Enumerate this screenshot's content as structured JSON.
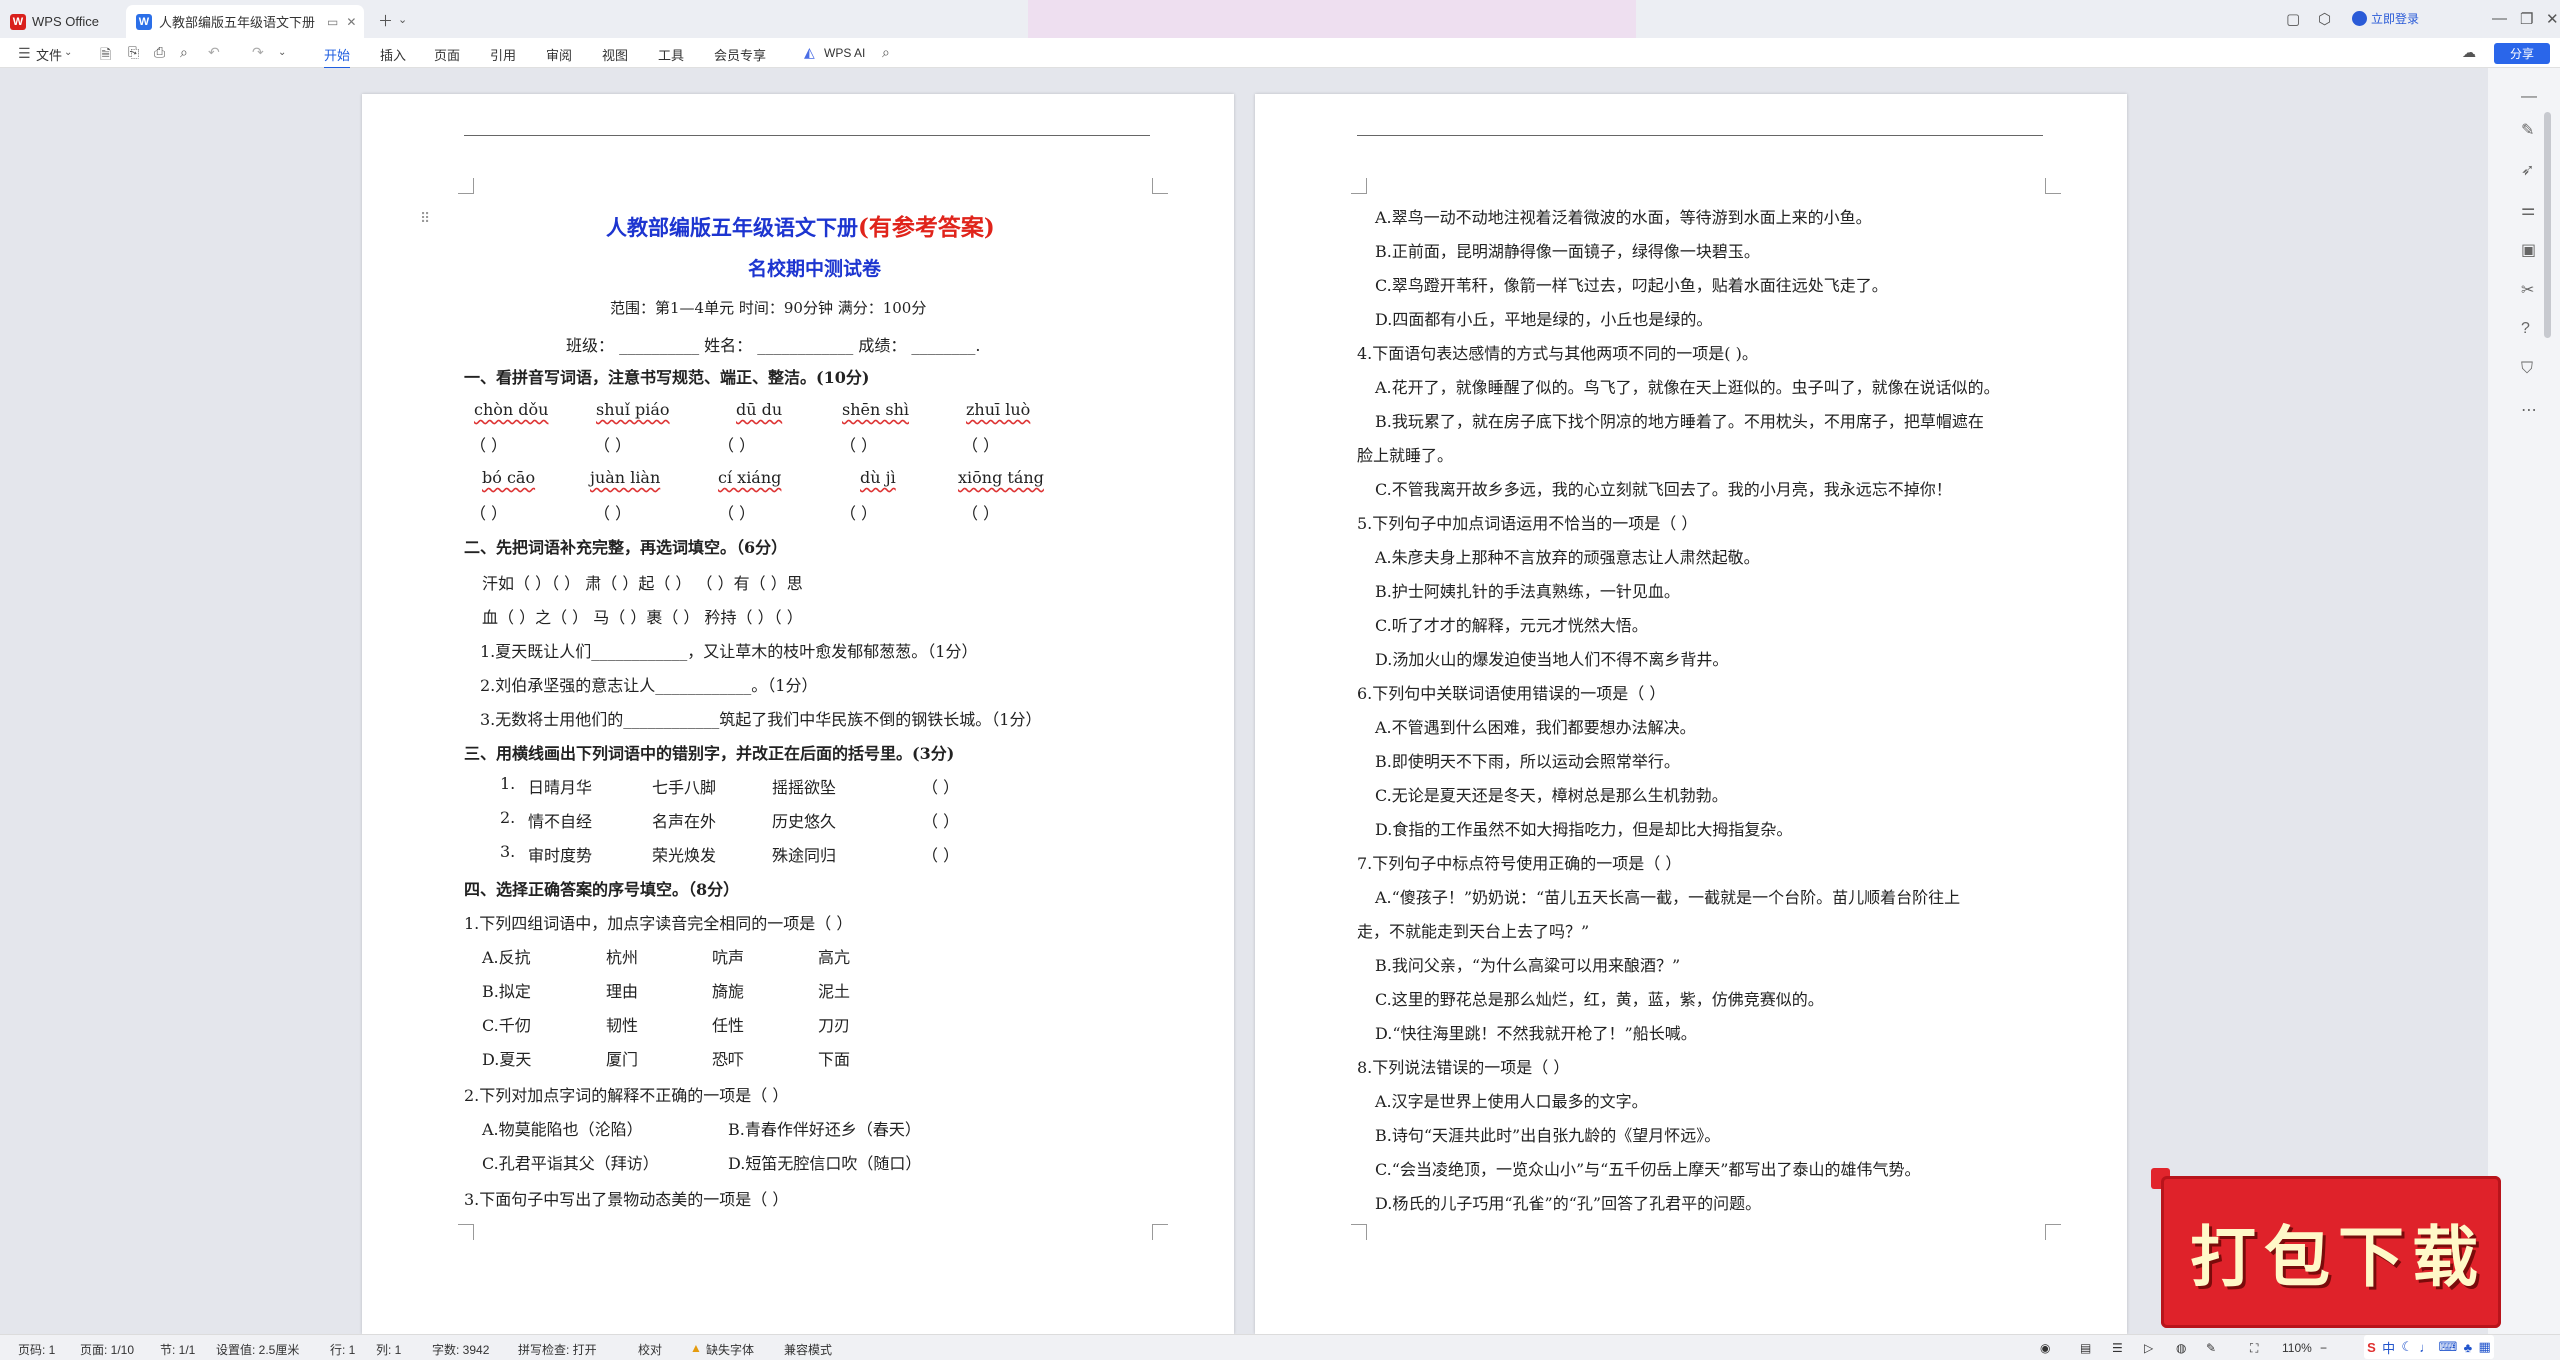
{
  "tabs": {
    "app_label": "WPS Office",
    "doc_title": "人教部编版五年级语文下册 名校期中测试卷"
  },
  "titlebar": {
    "login_label": "立即登录"
  },
  "toolbar": {
    "file_label": "文件",
    "menu": [
      "开始",
      "插入",
      "页面",
      "引用",
      "审阅",
      "视图",
      "工具",
      "会员专享"
    ],
    "ai_label": "WPS AI",
    "share_label": "分享"
  },
  "page1": {
    "title": "人教部编版五年级语文下册",
    "title_red": "(有参考答案)",
    "subtitle": "名校期中测试卷",
    "range_line": "范围：第1—4单元   时间：90分钟   满分：100分",
    "name_line": "班级：  __________   姓名：  ____________  成绩：  ________.",
    "s1_title": "一、看拼音写词语，注意书写规范、端正、整洁。(10分)",
    "pinyin_row1": [
      "chòn dǒu",
      "shuǐ piáo",
      "dū du",
      "shēn shì",
      "zhuī luò"
    ],
    "pinyin_row2": [
      "bó cāo",
      "juàn liàn",
      "cí xiáng",
      "dù jì",
      "xiōng táng"
    ],
    "paren": "（        ）",
    "s2_title": "二、先把词语补充完整，再选词填空。（6分）",
    "s2_row1": "汗如（    ）（    ）    肃（    ）起（    ）    （    ）有（    ）思",
    "s2_row2": "血（    ）之（    ）    马（    ）裹（    ）    矜持（    ）（    ）",
    "q1": "1.夏天既让人们____________，又让草木的枝叶愈发郁郁葱葱。（1分）",
    "q2": "2.刘伯承坚强的意志让人____________。（1分）",
    "q3": "3.无数将士用他们的____________筑起了我们中华民族不倒的钢铁长城。（1分）",
    "s3_title": "三、用横线画出下列词语中的错别字，并改正在后面的括号里。(3分)",
    "s3_rows": [
      {
        "n": "1.",
        "a": "日晴月华",
        "b": "七手八脚",
        "c": "摇摇欲坠",
        "p": "（        ）"
      },
      {
        "n": "2.",
        "a": "情不自经",
        "b": "名声在外",
        "c": "历史悠久",
        "p": "（        ）"
      },
      {
        "n": "3.",
        "a": "审时度势",
        "b": "荣光焕发",
        "c": "殊途同归",
        "p": "（        ）"
      }
    ],
    "s4_title": "四、选择正确答案的序号填空。（8分）",
    "s4_q1": "1.下列四组词语中，加点字读音完全相同的一项是（      ）",
    "s4_q1_opts": [
      [
        "A.反抗",
        "杭州",
        "吭声",
        "高亢"
      ],
      [
        "B.拟定",
        "理由",
        "旖旎",
        "泥土"
      ],
      [
        "C.千仞",
        "韧性",
        "任性",
        "刀刃"
      ],
      [
        "D.夏天",
        "厦门",
        "恐吓",
        "下面"
      ]
    ],
    "s4_q2": "2.下列对加点字词的解释不正确的一项是（      ）",
    "s4_q2_opts": [
      [
        "A.物莫能陷也（沦陷）",
        "B.青春作伴好还乡（春天）"
      ],
      [
        "C.孔君平诣其父（拜访）",
        "D.短笛无腔信口吹（随口）"
      ]
    ],
    "s4_q3": "3.下面句子中写出了景物动态美的一项是（      ）"
  },
  "page2": {
    "lines": [
      "A.翠鸟一动不动地注视着泛着微波的水面，等待游到水面上来的小鱼。",
      "B.正前面，昆明湖静得像一面镜子，绿得像一块碧玉。",
      "C.翠鸟蹬开苇秆，像箭一样飞过去，叼起小鱼，贴着水面往远处飞走了。",
      "D.四面都有小丘，平地是绿的，小丘也是绿的。",
      "4.下面语句表达感情的方式与其他两项不同的一项是(      )。",
      "A.花开了，就像睡醒了似的。鸟飞了，就像在天上逛似的。虫子叫了，就像在说话似的。",
      "B.我玩累了，就在房子底下找个阴凉的地方睡着了。不用枕头，不用席子，把草帽遮在",
      "脸上就睡了。",
      "C.不管我离开故乡多远，我的心立刻就飞回去了。我的小月亮，我永远忘不掉你！",
      "5.下列句子中加点词语运用不恰当的一项是（      ）",
      "A.朱彦夫身上那种不言放弃的顽强意志让人肃然起敬。",
      "B.护士阿姨扎针的手法真熟练，一针见血。",
      "C.听了才才的解释，元元才恍然大悟。",
      "D.汤加火山的爆发迫使当地人们不得不离乡背井。",
      "6.下列句中关联词语使用错误的一项是（      ）",
      "A.不管遇到什么困难，我们都要想办法解决。",
      "B.即使明天不下雨，所以运动会照常举行。",
      "C.无论是夏天还是冬天，樟树总是那么生机勃勃。",
      "D.食指的工作虽然不如大拇指吃力，但是却比大拇指复杂。",
      "7.下列句子中标点符号使用正确的一项是（      ）",
      "A.“傻孩子！”奶奶说：“苗儿五天长高一截，一截就是一个台阶。苗儿顺着台阶往上",
      "走，不就能走到天台上去了吗？”",
      "B.我问父亲，“为什么高粱可以用来酿酒？”",
      "C.这里的野花总是那么灿烂，红，黄，蓝，紫，仿佛竞赛似的。",
      "D.“快往海里跳！不然我就开枪了！”船长喊。",
      "8.下列说法错误的一项是（      ）",
      "A.汉字是世界上使用人口最多的文字。",
      "B.诗句“天涯共此时”出自张九龄的《望月怀远》。",
      "C.“会当凌绝顶，一览众山小”与“五千仞岳上摩天”都写出了泰山的雄伟气势。",
      "D.杨氏的儿子巧用“孔雀”的“孔”回答了孔君平的问题。"
    ]
  },
  "banner": {
    "text": "打包下载"
  },
  "statusbar": {
    "page_code": "页码: 1",
    "page": "页面: 1/10",
    "section": "节: 1/1",
    "setting": "设置值: 2.5厘米",
    "row": "行: 1",
    "col": "列: 1",
    "words": "字数: 3942",
    "spell": "拼写检查: 打开",
    "proof": "校对",
    "missing_font": "缺失字体",
    "compat": "兼容模式",
    "zoom": "110%"
  },
  "ime": {
    "label": "中"
  }
}
